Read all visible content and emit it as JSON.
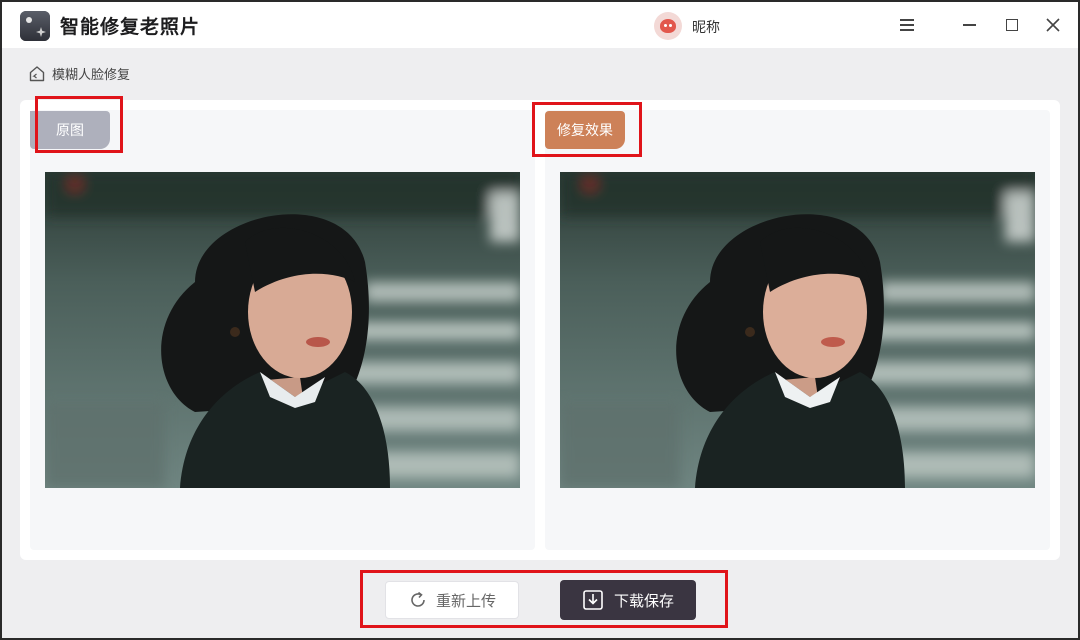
{
  "app": {
    "title": "智能修复老照片"
  },
  "user": {
    "nickname": "昵称"
  },
  "breadcrumb": {
    "label": "模糊人脸修复"
  },
  "panels": {
    "original_label": "原图",
    "result_label": "修复效果"
  },
  "actions": {
    "reupload_label": "重新上传",
    "download_label": "下载保存"
  },
  "colors": {
    "result_tag": "#cd8158",
    "original_tag": "#aeb0bc",
    "download_button": "#3a3541",
    "highlight": "#e0141a"
  },
  "icons": [
    "app-logo-icon",
    "avatar-icon",
    "menu-icon",
    "minimize-icon",
    "maximize-icon",
    "close-icon",
    "home-icon",
    "refresh-icon",
    "download-icon"
  ]
}
